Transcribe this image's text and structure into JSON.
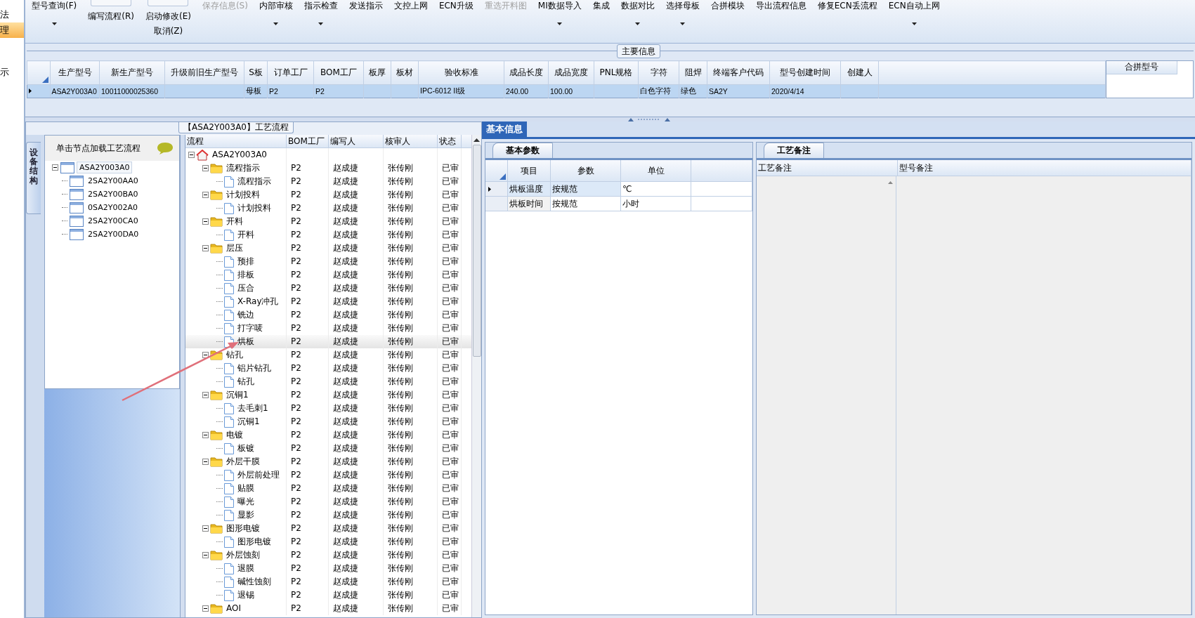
{
  "side_nav": {
    "items": [
      {
        "label": "法",
        "selected": false
      },
      {
        "label": "理",
        "selected": true
      }
    ],
    "note": "示"
  },
  "toolbar": [
    {
      "kind": "button",
      "label": "型号查询(F)",
      "dropdown": true,
      "disabled": false
    },
    {
      "kind": "stack",
      "lines": [
        "编写流程(R)"
      ]
    },
    {
      "kind": "stack",
      "lines": [
        "启动修改(E)",
        "取消(Z)"
      ]
    },
    {
      "kind": "button",
      "label": "保存信息(S)",
      "dropdown": false,
      "disabled": true
    },
    {
      "kind": "button",
      "label": "内部审核",
      "dropdown": true,
      "disabled": false
    },
    {
      "kind": "button",
      "label": "指示检查",
      "dropdown": true,
      "disabled": false
    },
    {
      "kind": "button",
      "label": "发送指示",
      "dropdown": false,
      "disabled": false
    },
    {
      "kind": "button",
      "label": "文控上网",
      "dropdown": false,
      "disabled": false
    },
    {
      "kind": "button",
      "label": "ECN升级",
      "dropdown": false,
      "disabled": false
    },
    {
      "kind": "button",
      "label": "重选开料图",
      "dropdown": false,
      "disabled": true
    },
    {
      "kind": "button",
      "label": "MI数据导入",
      "dropdown": true,
      "disabled": false
    },
    {
      "kind": "button",
      "label": "集成",
      "dropdown": false,
      "disabled": false
    },
    {
      "kind": "button",
      "label": "数据对比",
      "dropdown": true,
      "disabled": false
    },
    {
      "kind": "button",
      "label": "选择母板",
      "dropdown": true,
      "disabled": false
    },
    {
      "kind": "button",
      "label": "合拼模块",
      "dropdown": false,
      "disabled": false
    },
    {
      "kind": "button",
      "label": "导出流程信息",
      "dropdown": false,
      "disabled": false
    },
    {
      "kind": "button",
      "label": "修复ECN丢流程",
      "dropdown": false,
      "disabled": false
    },
    {
      "kind": "button",
      "label": "ECN自动上网",
      "dropdown": true,
      "disabled": false
    }
  ],
  "main_info": {
    "title": "主要信息",
    "columns": [
      "生产型号",
      "新生产型号",
      "升级前旧生产型号",
      "S板",
      "订单工厂",
      "BOM工厂",
      "板厚",
      "板材",
      "验收标准",
      "成品长度",
      "成品宽度",
      "PNL规格",
      "字符",
      "阻焊",
      "终端客户代码",
      "型号创建时间",
      "创建人"
    ],
    "rows": [
      {
        "selected": true,
        "cells": [
          "ASA2Y003A0",
          "10011000025360",
          "",
          "母板",
          "P2",
          "P2",
          "",
          "",
          "IPC-6012 II级",
          "240.00",
          "100.00",
          "",
          "白色字符",
          "绿色",
          "SA2Y",
          "2020/4/14",
          ""
        ]
      }
    ],
    "merge_panel": {
      "column": "合拼型号"
    }
  },
  "flow": {
    "title": "【ASA2Y003A0】工艺流程",
    "side_tab": "设备结构",
    "tree": {
      "header": "单击节点加载工艺流程",
      "nodes": [
        {
          "label": "ASA2Y003A0",
          "selected": true,
          "expanded": true,
          "children": [
            {
              "label": "2SA2Y00AA0",
              "selected": false
            },
            {
              "label": "2SA2Y00BA0",
              "selected": false
            },
            {
              "label": "0SA2Y002A0",
              "selected": false
            },
            {
              "label": "2SA2Y00CA0",
              "selected": false
            },
            {
              "label": "2SA2Y00DA0",
              "selected": false
            }
          ]
        }
      ]
    },
    "columns": [
      "流程",
      "BOM工厂",
      "编写人",
      "核审人",
      "状态"
    ],
    "rows": [
      {
        "name": "ASA2Y003A0",
        "kind": "root",
        "expanded": true,
        "selected": false,
        "children": [
          {
            "name": "流程指示",
            "kind": "folder",
            "expanded": true,
            "selected": false,
            "bom": "P2",
            "writer": "赵成捷",
            "reviewer": "张传刚",
            "status": "已审",
            "children": [
              {
                "name": "流程指示",
                "kind": "step",
                "selected": false,
                "bom": "P2",
                "writer": "赵成捷",
                "reviewer": "张传刚",
                "status": "已审"
              }
            ]
          },
          {
            "name": "计划投料",
            "kind": "folder",
            "expanded": true,
            "selected": false,
            "bom": "P2",
            "writer": "赵成捷",
            "reviewer": "张传刚",
            "status": "已审",
            "children": [
              {
                "name": "计划投料",
                "kind": "step",
                "selected": false,
                "bom": "P2",
                "writer": "赵成捷",
                "reviewer": "张传刚",
                "status": "已审"
              }
            ]
          },
          {
            "name": "开料",
            "kind": "folder",
            "expanded": true,
            "selected": false,
            "bom": "P2",
            "writer": "赵成捷",
            "reviewer": "张传刚",
            "status": "已审",
            "children": [
              {
                "name": "开料",
                "kind": "step",
                "selected": false,
                "bom": "P2",
                "writer": "赵成捷",
                "reviewer": "张传刚",
                "status": "已审"
              }
            ]
          },
          {
            "name": "层压",
            "kind": "folder",
            "expanded": true,
            "selected": false,
            "bom": "P2",
            "writer": "赵成捷",
            "reviewer": "张传刚",
            "status": "已审",
            "children": [
              {
                "name": "预排",
                "kind": "step",
                "selected": false,
                "bom": "P2",
                "writer": "赵成捷",
                "reviewer": "张传刚",
                "status": "已审"
              },
              {
                "name": "排板",
                "kind": "step",
                "selected": false,
                "bom": "P2",
                "writer": "赵成捷",
                "reviewer": "张传刚",
                "status": "已审"
              },
              {
                "name": "压合",
                "kind": "step",
                "selected": false,
                "bom": "P2",
                "writer": "赵成捷",
                "reviewer": "张传刚",
                "status": "已审"
              },
              {
                "name": "X-Ray冲孔",
                "kind": "step",
                "selected": false,
                "bom": "P2",
                "writer": "赵成捷",
                "reviewer": "张传刚",
                "status": "已审"
              },
              {
                "name": "铣边",
                "kind": "step",
                "selected": false,
                "bom": "P2",
                "writer": "赵成捷",
                "reviewer": "张传刚",
                "status": "已审"
              },
              {
                "name": "打字唛",
                "kind": "step",
                "selected": false,
                "bom": "P2",
                "writer": "赵成捷",
                "reviewer": "张传刚",
                "status": "已审"
              },
              {
                "name": "烘板",
                "kind": "step",
                "selected": true,
                "bom": "P2",
                "writer": "赵成捷",
                "reviewer": "张传刚",
                "status": "已审"
              }
            ]
          },
          {
            "name": "钻孔",
            "kind": "folder",
            "expanded": true,
            "selected": false,
            "bom": "P2",
            "writer": "赵成捷",
            "reviewer": "张传刚",
            "status": "已审",
            "children": [
              {
                "name": "铝片钻孔",
                "kind": "step",
                "selected": false,
                "bom": "P2",
                "writer": "赵成捷",
                "reviewer": "张传刚",
                "status": "已审"
              },
              {
                "name": "钻孔",
                "kind": "step",
                "selected": false,
                "bom": "P2",
                "writer": "赵成捷",
                "reviewer": "张传刚",
                "status": "已审"
              }
            ]
          },
          {
            "name": "沉铜1",
            "kind": "folder",
            "expanded": true,
            "selected": false,
            "bom": "P2",
            "writer": "赵成捷",
            "reviewer": "张传刚",
            "status": "已审",
            "children": [
              {
                "name": "去毛刺1",
                "kind": "step",
                "selected": false,
                "bom": "P2",
                "writer": "赵成捷",
                "reviewer": "张传刚",
                "status": "已审"
              },
              {
                "name": "沉铜1",
                "kind": "step",
                "selected": false,
                "bom": "P2",
                "writer": "赵成捷",
                "reviewer": "张传刚",
                "status": "已审"
              }
            ]
          },
          {
            "name": "电镀",
            "kind": "folder",
            "expanded": true,
            "selected": false,
            "bom": "P2",
            "writer": "赵成捷",
            "reviewer": "张传刚",
            "status": "已审",
            "children": [
              {
                "name": "板镀",
                "kind": "step",
                "selected": false,
                "bom": "P2",
                "writer": "赵成捷",
                "reviewer": "张传刚",
                "status": "已审"
              }
            ]
          },
          {
            "name": "外层干膜",
            "kind": "folder",
            "expanded": true,
            "selected": false,
            "bom": "P2",
            "writer": "赵成捷",
            "reviewer": "张传刚",
            "status": "已审",
            "children": [
              {
                "name": "外层前处理",
                "kind": "step",
                "selected": false,
                "bom": "P2",
                "writer": "赵成捷",
                "reviewer": "张传刚",
                "status": "已审"
              },
              {
                "name": "贴膜",
                "kind": "step",
                "selected": false,
                "bom": "P2",
                "writer": "赵成捷",
                "reviewer": "张传刚",
                "status": "已审"
              },
              {
                "name": "曝光",
                "kind": "step",
                "selected": false,
                "bom": "P2",
                "writer": "赵成捷",
                "reviewer": "张传刚",
                "status": "已审"
              },
              {
                "name": "显影",
                "kind": "step",
                "selected": false,
                "bom": "P2",
                "writer": "赵成捷",
                "reviewer": "张传刚",
                "status": "已审"
              }
            ]
          },
          {
            "name": "图形电镀",
            "kind": "folder",
            "expanded": true,
            "selected": false,
            "bom": "P2",
            "writer": "赵成捷",
            "reviewer": "张传刚",
            "status": "已审",
            "children": [
              {
                "name": "图形电镀",
                "kind": "step",
                "selected": false,
                "bom": "P2",
                "writer": "赵成捷",
                "reviewer": "张传刚",
                "status": "已审"
              }
            ]
          },
          {
            "name": "外层蚀刻",
            "kind": "folder",
            "expanded": true,
            "selected": false,
            "bom": "P2",
            "writer": "赵成捷",
            "reviewer": "张传刚",
            "status": "已审",
            "children": [
              {
                "name": "退膜",
                "kind": "step",
                "selected": false,
                "bom": "P2",
                "writer": "赵成捷",
                "reviewer": "张传刚",
                "status": "已审"
              },
              {
                "name": "碱性蚀刻",
                "kind": "step",
                "selected": false,
                "bom": "P2",
                "writer": "赵成捷",
                "reviewer": "张传刚",
                "status": "已审"
              },
              {
                "name": "退锡",
                "kind": "step",
                "selected": false,
                "bom": "P2",
                "writer": "赵成捷",
                "reviewer": "张传刚",
                "status": "已审"
              }
            ]
          },
          {
            "name": "AOI",
            "kind": "folder",
            "expanded": true,
            "selected": false,
            "bom": "P2",
            "writer": "赵成捷",
            "reviewer": "张传刚",
            "status": "已审"
          }
        ]
      }
    ]
  },
  "details": {
    "tabs": [
      {
        "label": "基本信息",
        "selected": true
      }
    ],
    "params": {
      "tab": "基本参数",
      "columns": [
        "项目",
        "参数",
        "单位"
      ],
      "rows": [
        {
          "current": true,
          "cells": [
            "烘板温度",
            "按规范",
            "℃"
          ]
        },
        {
          "current": false,
          "cells": [
            "烘板时间",
            "按规范",
            "小时"
          ]
        }
      ]
    },
    "notes": {
      "tab": "工艺备注",
      "columns": [
        "工艺备注",
        "型号备注"
      ]
    }
  }
}
